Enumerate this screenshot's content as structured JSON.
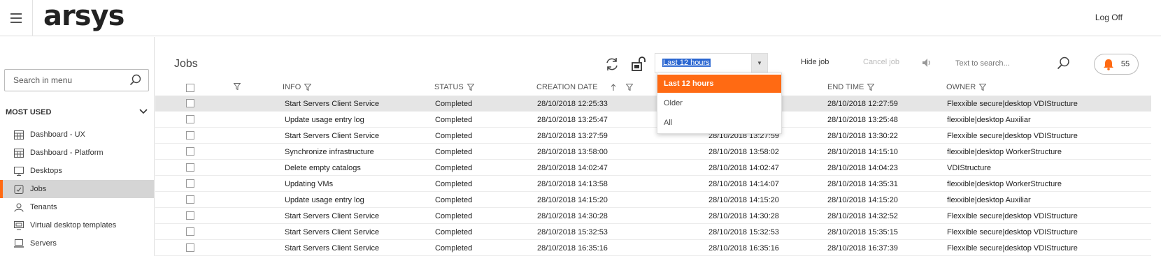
{
  "brand": {
    "logo_text": "arsys",
    "accent": "#ff6a13"
  },
  "topbar": {
    "logoff_label": "Log Off"
  },
  "sidebar": {
    "search_placeholder": "Search in menu",
    "section_label": "MOST USED",
    "items": [
      {
        "label": "Dashboard - UX",
        "icon": "dashboard-icon",
        "active": false
      },
      {
        "label": "Dashboard - Platform",
        "icon": "dashboard-icon",
        "active": false
      },
      {
        "label": "Desktops",
        "icon": "monitor-icon",
        "active": false
      },
      {
        "label": "Jobs",
        "icon": "jobs-icon",
        "active": true
      },
      {
        "label": "Tenants",
        "icon": "users-icon",
        "active": false
      },
      {
        "label": "Virtual desktop templates",
        "icon": "template-icon",
        "active": false
      },
      {
        "label": "Servers",
        "icon": "server-icon",
        "active": false
      }
    ]
  },
  "toolbar": {
    "title": "Jobs",
    "time_filter_value": "Last 12 hours",
    "hide_job_label": "Hide job",
    "cancel_job_label": "Cancel job",
    "search_placeholder": "Text to search...",
    "notification_count": "55"
  },
  "dropdown": {
    "options": [
      {
        "label": "Last 12 hours",
        "active": true
      },
      {
        "label": "Older",
        "active": false
      },
      {
        "label": "All",
        "active": false
      }
    ]
  },
  "table": {
    "columns": {
      "info": "INFO",
      "status": "STATUS",
      "creation_date": "CREATION DATE",
      "end_time": "END TIME",
      "owner": "OWNER"
    },
    "rows": [
      {
        "info": "Start Servers Client Service",
        "status": "Completed",
        "creation": "28/10/2018 12:25:33",
        "start": "",
        "end": "28/10/2018 12:27:59",
        "owner": "Flexxible secure|desktop VDIStructure",
        "selected": true
      },
      {
        "info": "Update usage entry log",
        "status": "Completed",
        "creation": "28/10/2018 13:25:47",
        "start": "",
        "end": "28/10/2018 13:25:48",
        "owner": "flexxible|desktop Auxiliar",
        "selected": false
      },
      {
        "info": "Start Servers Client Service",
        "status": "Completed",
        "creation": "28/10/2018 13:27:59",
        "start": "28/10/2018 13:27:59",
        "end": "28/10/2018 13:30:22",
        "owner": "Flexxible secure|desktop VDIStructure",
        "selected": false
      },
      {
        "info": "Synchronize infrastructure",
        "status": "Completed",
        "creation": "28/10/2018 13:58:00",
        "start": "28/10/2018 13:58:02",
        "end": "28/10/2018 14:15:10",
        "owner": "flexxible|desktop WorkerStructure",
        "selected": false
      },
      {
        "info": "Delete empty catalogs",
        "status": "Completed",
        "creation": "28/10/2018 14:02:47",
        "start": "28/10/2018 14:02:47",
        "end": "28/10/2018 14:04:23",
        "owner": "VDIStructure",
        "selected": false
      },
      {
        "info": "Updating VMs",
        "status": "Completed",
        "creation": "28/10/2018 14:13:58",
        "start": "28/10/2018 14:14:07",
        "end": "28/10/2018 14:35:31",
        "owner": "flexxible|desktop WorkerStructure",
        "selected": false
      },
      {
        "info": "Update usage entry log",
        "status": "Completed",
        "creation": "28/10/2018 14:15:20",
        "start": "28/10/2018 14:15:20",
        "end": "28/10/2018 14:15:20",
        "owner": "flexxible|desktop Auxiliar",
        "selected": false
      },
      {
        "info": "Start Servers Client Service",
        "status": "Completed",
        "creation": "28/10/2018 14:30:28",
        "start": "28/10/2018 14:30:28",
        "end": "28/10/2018 14:32:52",
        "owner": "Flexxible secure|desktop VDIStructure",
        "selected": false
      },
      {
        "info": "Start Servers Client Service",
        "status": "Completed",
        "creation": "28/10/2018 15:32:53",
        "start": "28/10/2018 15:32:53",
        "end": "28/10/2018 15:35:15",
        "owner": "Flexxible secure|desktop VDIStructure",
        "selected": false
      },
      {
        "info": "Start Servers Client Service",
        "status": "Completed",
        "creation": "28/10/2018 16:35:16",
        "start": "28/10/2018 16:35:16",
        "end": "28/10/2018 16:37:39",
        "owner": "Flexxible secure|desktop VDIStructure",
        "selected": false
      }
    ]
  }
}
